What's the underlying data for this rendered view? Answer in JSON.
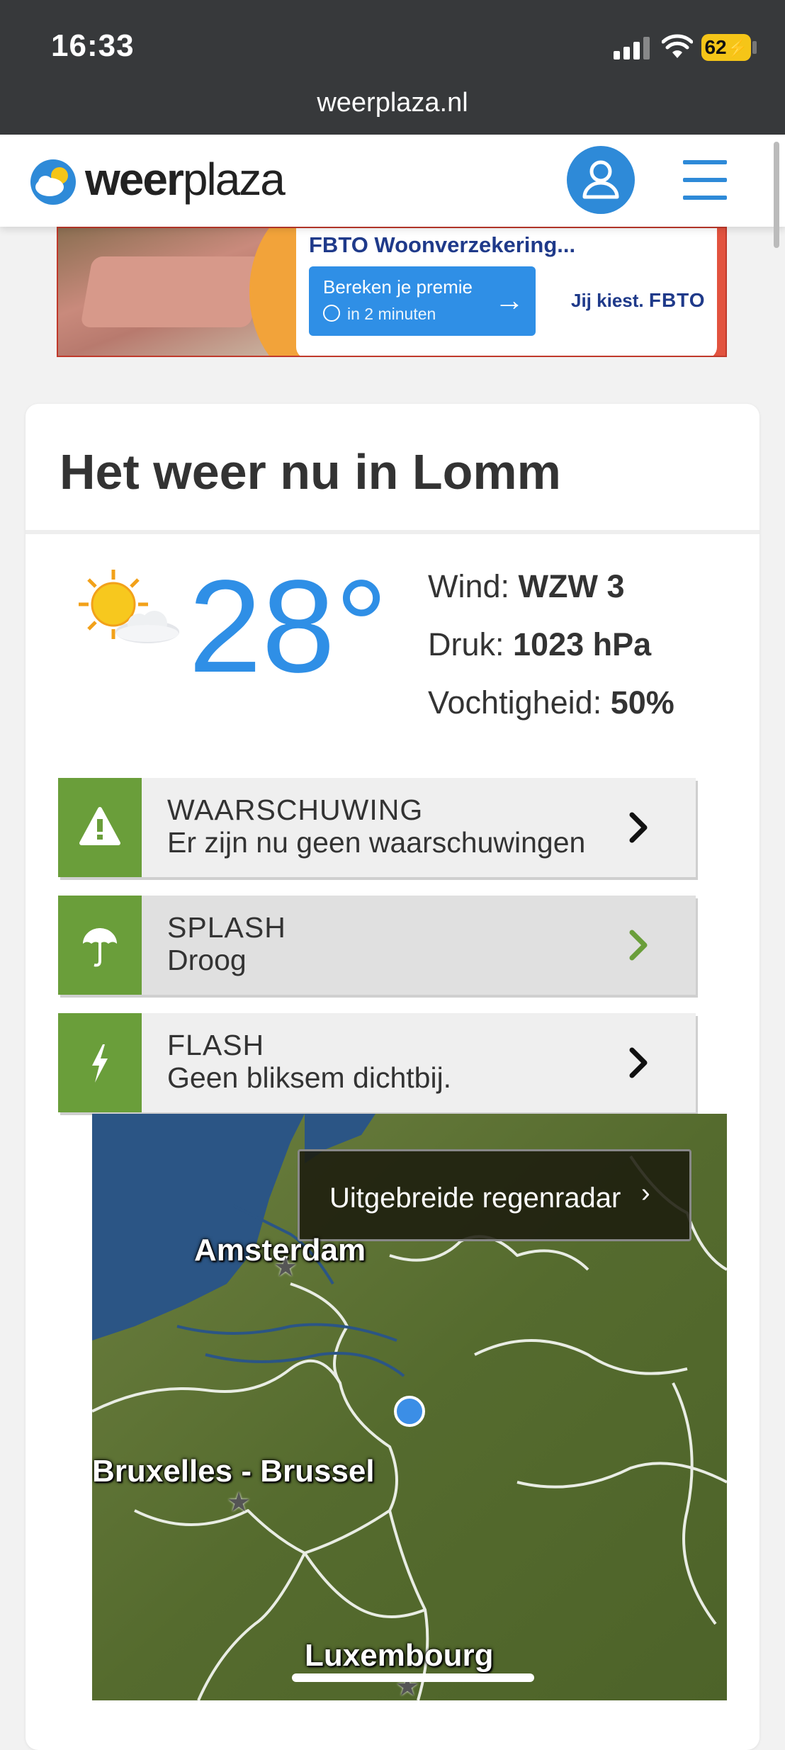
{
  "status_bar": {
    "time": "16:33",
    "battery": "62",
    "url": "weerplaza.nl"
  },
  "header": {
    "logo_bold": "weer",
    "logo_light": "plaza",
    "user_icon": "user-icon",
    "menu_icon": "hamburger-menu-icon",
    "brand_color": "#2e8ad8"
  },
  "ad": {
    "title": "FBTO Woonverzekering...",
    "cta_label": "Bereken je premie",
    "cta_sub": "in 2 minuten",
    "brand_text": "Jij kiest.",
    "brand_name": "FBTO"
  },
  "weather": {
    "title": "Het weer nu in Lomm",
    "temperature": "28°",
    "icon": "sun-cloud-icon",
    "wind_label": "Wind:",
    "wind_value": "WZW 3",
    "pressure_label": "Druk:",
    "pressure_value": "1023 hPa",
    "humidity_label": "Vochtigheid:",
    "humidity_value": "50%",
    "temp_color": "#2f8fe6",
    "accent_green": "#6a9e3a"
  },
  "alerts": [
    {
      "label": "WAARSCHUWING",
      "value": "Er zijn nu geen waarschuwingen",
      "icon": "warning-icon"
    },
    {
      "label": "SPLASH",
      "value": "Droog",
      "icon": "umbrella-icon"
    },
    {
      "label": "FLASH",
      "value": "Geen bliksem dichtbij.",
      "icon": "lightning-icon"
    }
  ],
  "radar": {
    "button_label": "Uitgebreide regenradar",
    "cities": [
      "Amsterdam",
      "Bruxelles - Brussel",
      "Luxembourg"
    ]
  }
}
